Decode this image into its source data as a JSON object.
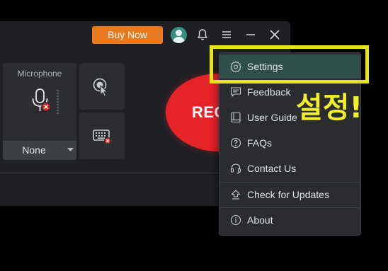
{
  "titlebar": {
    "buy_now_label": "Buy Now",
    "icons": [
      "avatar",
      "bell-icon",
      "menu-icon",
      "minimize-icon",
      "close-icon"
    ]
  },
  "recorder": {
    "microphone_label": "Microphone",
    "microphone_selected": "None",
    "record_label": "REC"
  },
  "menu": {
    "items": [
      {
        "label": "Settings",
        "icon": "gear-icon",
        "active": true
      },
      {
        "label": "Feedback",
        "icon": "feedback-icon"
      },
      {
        "label": "User Guide",
        "icon": "book-icon"
      },
      {
        "label": "FAQs",
        "icon": "help-icon"
      },
      {
        "label": "Contact Us",
        "icon": "headset-icon"
      },
      {
        "label": "Check for Updates",
        "icon": "upload-icon"
      },
      {
        "label": "About",
        "icon": "info-icon"
      }
    ]
  },
  "annotation": {
    "text": "설정!"
  },
  "colors": {
    "accent_orange": "#e8791f",
    "record_red": "#e7232a",
    "highlight_yellow": "#e5e517",
    "menu_active": "#2f4f4a",
    "avatar_teal": "#3a8f82"
  }
}
